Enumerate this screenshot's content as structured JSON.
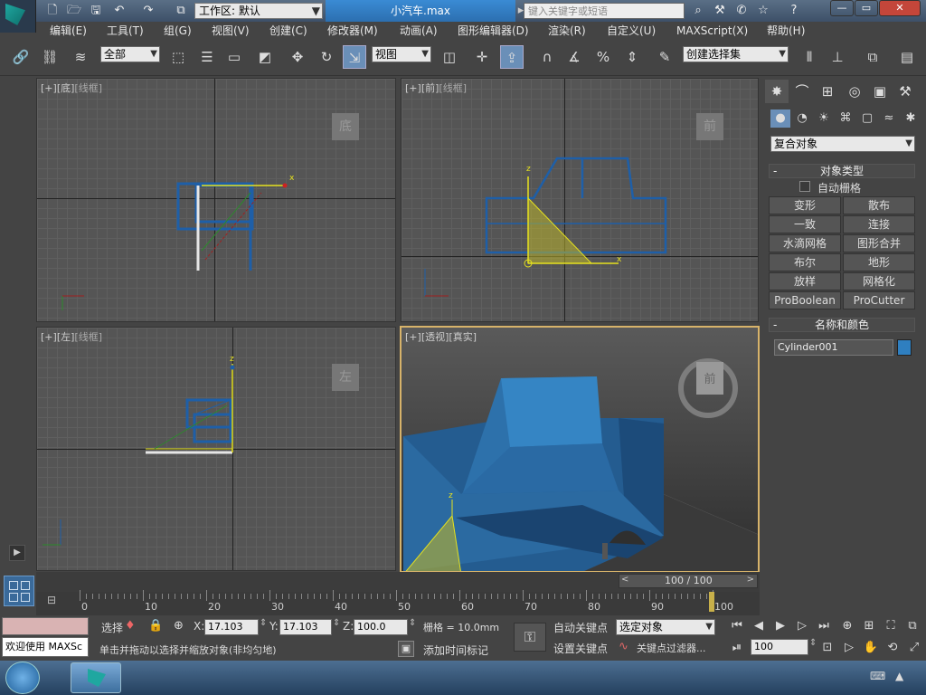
{
  "app": {
    "file_title": "小汽车.max",
    "workspace": "工作区: 默认",
    "search_placeholder": "键入关键字或短语"
  },
  "menu": [
    "编辑(E)",
    "工具(T)",
    "组(G)",
    "视图(V)",
    "创建(C)",
    "修改器(M)",
    "动画(A)",
    "图形编辑器(D)",
    "渲染(R)",
    "自定义(U)",
    "MAXScript(X)",
    "帮助(H)"
  ],
  "toolbar": {
    "selection_filter": "全部",
    "reference_coord": "视图",
    "named_selection": "创建选择集"
  },
  "viewports": {
    "top_left": {
      "label_plus": "[+]",
      "label_view": "[底]",
      "label_mode": "[线框]",
      "cube_text": "底"
    },
    "top_right": {
      "label_plus": "[+]",
      "label_view": "[前]",
      "label_mode": "[线框]",
      "cube_text": "前"
    },
    "bottom_left": {
      "label_plus": "[+]",
      "label_view": "[左]",
      "label_mode": "[线框]",
      "cube_text": "左"
    },
    "bottom_right": {
      "label_plus": "[+]",
      "label_view": "[透视]",
      "label_mode": "[真实]",
      "cube_text": "前"
    }
  },
  "command_panel": {
    "category": "复合对象",
    "object_type_title": "对象类型",
    "autogrid_label": "自动栅格",
    "buttons": [
      "变形",
      "散布",
      "一致",
      "连接",
      "水滴网格",
      "图形合并",
      "布尔",
      "地形",
      "放样",
      "网格化",
      "ProBoolean",
      "ProCutter"
    ],
    "name_color_title": "名称和颜色",
    "object_name": "Cylinder001",
    "object_color": "#2f7fc0"
  },
  "timeline": {
    "frame_display": "100 / 100",
    "ticks": [
      "0",
      "10",
      "20",
      "30",
      "40",
      "50",
      "60",
      "70",
      "80",
      "90",
      "100"
    ],
    "current_frame": 100
  },
  "status": {
    "welcome": "欢迎使用 MAXSc",
    "select_label": "选择",
    "x_label": "X:",
    "x_value": "17.103",
    "y_label": "Y:",
    "y_value": "17.103",
    "z_label": "Z:",
    "z_value": "100.0",
    "grid": "栅格 = 10.0mm",
    "prompt": "单击并拖动以选择并缩放对象(非均匀地)",
    "add_time_tag": "添加时间标记",
    "auto_key": "自动关键点",
    "set_key": "设置关键点",
    "key_mode": "选定对象",
    "key_filters": "关键点过滤器...",
    "frame_field": "100"
  },
  "colors": {
    "accent": "#d7b36a",
    "model_blue": "#1e5fa8",
    "gizmo_yellow": "#e6e21e"
  }
}
